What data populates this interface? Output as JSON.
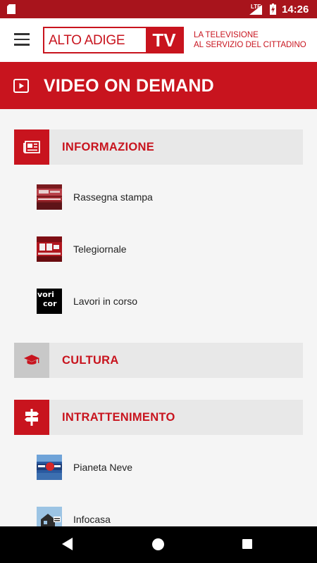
{
  "status_bar": {
    "network": "LTE",
    "time": "14:26"
  },
  "app_bar": {
    "logo_text": "ALTO ADIGE",
    "logo_tv": "TV",
    "tagline_line1": "LA TELEVISIONE",
    "tagline_line2": "AL SERVIZIO DEL CITTADINO"
  },
  "page": {
    "title": "VIDEO ON DEMAND"
  },
  "categories": [
    {
      "label": "INFORMAZIONE",
      "icon": "newspaper-icon",
      "items": [
        {
          "label": "Rassegna stampa",
          "thumb": "rassegna-thumbnail"
        },
        {
          "label": "Telegiornale",
          "thumb": "tg-thumbnail"
        },
        {
          "label": "Lavori in corso",
          "thumb": "lavori-thumbnail",
          "thumb_text_1": "vori",
          "thumb_text_2": "cor"
        }
      ]
    },
    {
      "label": "CULTURA",
      "icon": "graduation-cap-icon",
      "items": []
    },
    {
      "label": "INTRATTENIMENTO",
      "icon": "signpost-icon",
      "items": [
        {
          "label": "Pianeta Neve",
          "thumb": "pianeta-neve-thumbnail"
        },
        {
          "label": "Infocasa",
          "thumb": "infocasa-thumbnail"
        }
      ]
    }
  ],
  "colors": {
    "brand": "#c8141e",
    "status_bar": "#a8141c",
    "category_bg": "#e8e8e8",
    "background": "#f5f5f5"
  }
}
